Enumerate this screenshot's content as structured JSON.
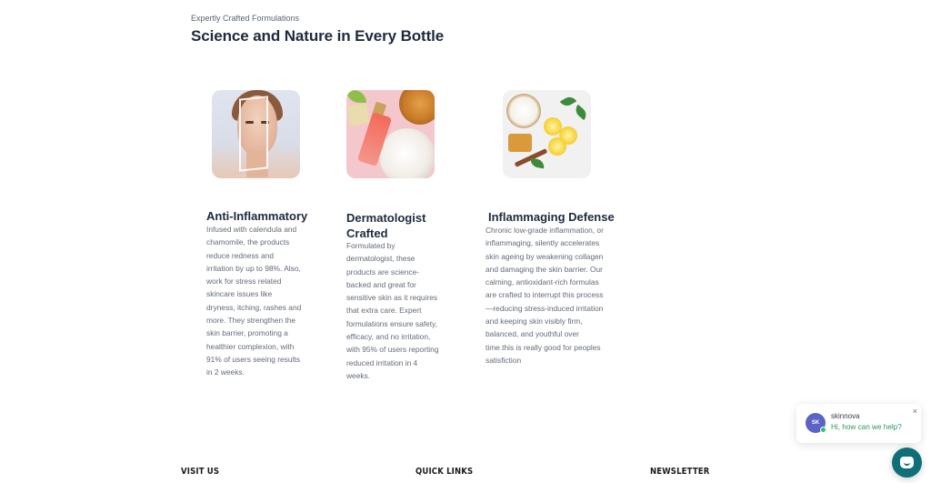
{
  "section": {
    "eyebrow": "Expertly Crafted Formulations",
    "title": "Science and Nature in Every Bottle"
  },
  "cards": [
    {
      "title": "Anti-Inflammatory",
      "description_lines": [
        "Infused with calendula and",
        "chamomile, the products",
        "reduce redness and",
        "irritation by up to 98%. Also,",
        "work for stress related",
        "skincare issues like",
        "dryness, itching, rashes and",
        "more. They strengthen the",
        "skin barrier, promoting a",
        "healthier complexion, with",
        "91% of users seeing results",
        "in 2 weeks."
      ]
    },
    {
      "title_lines": [
        "Dermatologist",
        "Crafted"
      ],
      "description_lines": [
        "Formulated by",
        "dermatologist, these",
        "products are science-",
        "backed and great for",
        "sensitive skin as it requires",
        "that extra care. Expert",
        "formulations ensure safety,",
        "efficacy, and no irritation,",
        "with 95% of users reporting",
        "reduced irritation in 4",
        "weeks."
      ]
    },
    {
      "title": "Inflammaging Defense",
      "description_lines": [
        "Chronic low-grade inflammation, or",
        "inflammaging, silently accelerates",
        "skin ageing by weakening collagen",
        "and damaging the skin barrier. Our",
        "calming, antioxidant-rich formulas",
        "are crafted to interrupt this process",
        "—reducing stress-induced irritation",
        "and keeping skin visibly firm,",
        "balanced, and youthful over",
        "time.this is really good for peoples",
        "satisfiction"
      ]
    }
  ],
  "chat": {
    "avatar_initials": "SK",
    "name": "skinnova",
    "message": "Hi, how can we help?",
    "close": "×"
  },
  "footer": {
    "visit": "VISIT US",
    "links": "QUICK LINKS",
    "newsletter": "NEWSLETTER"
  },
  "colors": {
    "title": "#1e2a3d",
    "chat_accent": "#0f6f78",
    "avatar": "#5b63c7"
  },
  "icons": {
    "chat_fab": "chat-bubble-icon",
    "close": "close-icon"
  }
}
